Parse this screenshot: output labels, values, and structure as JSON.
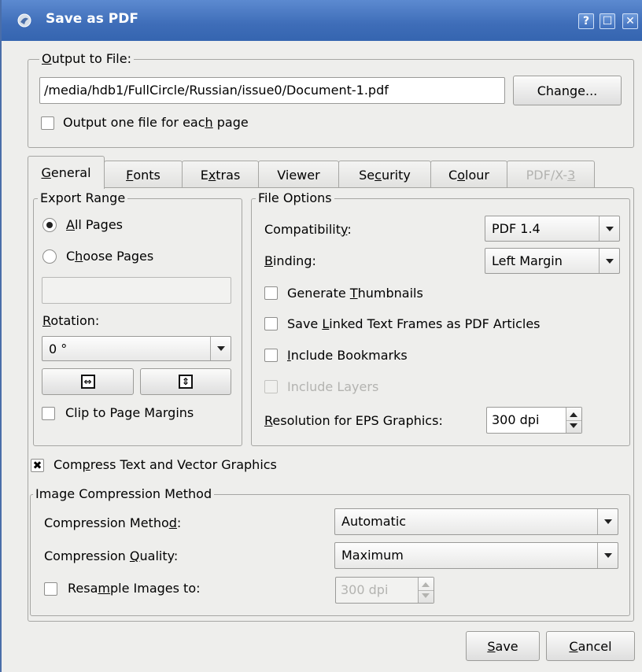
{
  "window": {
    "title": "Save as PDF",
    "titlebar_buttons": {
      "help": "?",
      "maximize": "☐",
      "close": "✕"
    },
    "app_icon": "scribus-icon",
    "title_color": "#3e6db8"
  },
  "output": {
    "group_label_pre": "O",
    "group_label_rest": "utput to File:",
    "file_path": "/media/hdb1/FullCircle/Russian/issue0/Document-1.pdf",
    "change_pre": "Chan",
    "change_u": "g",
    "change_post": "e...",
    "one_file_pre": "Output one file for eac",
    "one_file_u": "h",
    "one_file_post": " page",
    "one_file_checked": false
  },
  "tabs": [
    {
      "u": "G",
      "rest": "eneral",
      "active": true,
      "enabled": true
    },
    {
      "u": "F",
      "rest": "onts",
      "active": false,
      "enabled": true
    },
    {
      "pre": "E",
      "u": "x",
      "rest": "tras",
      "active": false,
      "enabled": true
    },
    {
      "label": "Viewer",
      "active": false,
      "enabled": true
    },
    {
      "pre": "Se",
      "u": "c",
      "rest": "urity",
      "active": false,
      "enabled": true
    },
    {
      "pre": "C",
      "u": "o",
      "rest": "lour",
      "active": false,
      "enabled": true
    },
    {
      "pre": "PDF/X-",
      "u": "3",
      "rest": "",
      "active": false,
      "enabled": false
    }
  ],
  "export_range": {
    "legend": "Export Range",
    "all_pages_u": "A",
    "all_pages_rest": "ll Pages",
    "all_pages_selected": true,
    "choose_pre": "C",
    "choose_u": "h",
    "choose_rest": "oose Pages",
    "pages_value": "",
    "rotation_u": "R",
    "rotation_rest": "otation:",
    "rotation_value": "0 °",
    "flip_h_icon": "flip-horizontal-icon",
    "flip_v_icon": "flip-vertical-icon",
    "clip_label": "Clip to Page Margins",
    "clip_checked": false
  },
  "file_options": {
    "legend": "File Options",
    "compat_pre": "Compatibilit",
    "compat_u": "y",
    "compat_post": ":",
    "compat_value": "PDF 1.4",
    "binding_u": "B",
    "binding_rest": "inding:",
    "binding_value": "Left Margin",
    "thumbs_pre": "Generate ",
    "thumbs_u": "T",
    "thumbs_rest": "humbnails",
    "linked_pre": "Save ",
    "linked_u": "L",
    "linked_rest": "inked Text Frames as PDF Articles",
    "bookmarks_u": "I",
    "bookmarks_rest": "nclude Bookmarks",
    "layers_label": "Include Layers",
    "layers_enabled": false,
    "res_u": "R",
    "res_rest": "esolution for EPS Graphics:",
    "res_value": "300 dpi"
  },
  "compress": {
    "pre": "Com",
    "u": "p",
    "rest": "ress Text and Vector Graphics",
    "checked": true,
    "check_mark": "✖"
  },
  "image_compression": {
    "legend": "Image Compression Method",
    "method_pre": "Compression Metho",
    "method_u": "d",
    "method_post": ":",
    "method_value": "Automatic",
    "quality_pre": "Compression ",
    "quality_u": "Q",
    "quality_rest": "uality:",
    "quality_value": "Maximum",
    "resample_pre": "Resa",
    "resample_u": "m",
    "resample_rest": "ple Images to:",
    "resample_checked": false,
    "resample_value": "300 dpi"
  },
  "footer": {
    "save_u": "S",
    "save_rest": "ave",
    "cancel_u": "C",
    "cancel_rest": "ancel"
  }
}
